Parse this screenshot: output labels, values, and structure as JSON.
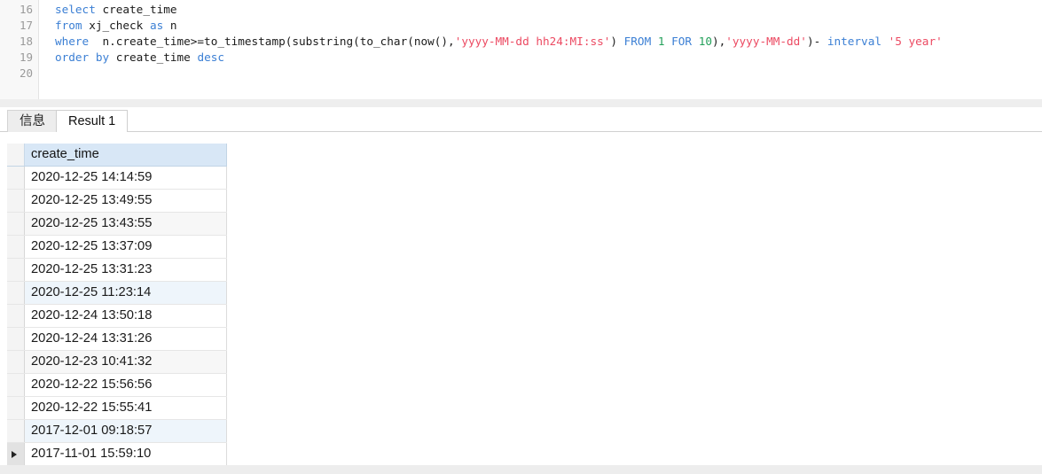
{
  "editor": {
    "line_numbers": [
      "16",
      "17",
      "18",
      "19",
      "20"
    ],
    "lines": [
      {
        "number": "16",
        "text": "select create_time",
        "tokens": [
          {
            "t": "select",
            "c": "kw"
          },
          {
            "t": " create_time",
            "c": "pln"
          }
        ]
      },
      {
        "number": "17",
        "text": "from xj_check as n",
        "tokens": [
          {
            "t": "from",
            "c": "kw"
          },
          {
            "t": " xj_check ",
            "c": "pln"
          },
          {
            "t": "as",
            "c": "kw"
          },
          {
            "t": " n",
            "c": "pln"
          }
        ]
      },
      {
        "number": "18",
        "text": "where  n.create_time>=to_timestamp(substring(to_char(now(),'yyyy-MM-dd hh24:MI:ss') FROM 1 FOR 10),'yyyy-MM-dd')- interval '5 year'",
        "tokens": [
          {
            "t": "where",
            "c": "kw"
          },
          {
            "t": "  n.create_time>=to_timestamp(substring(to_char(now(),",
            "c": "pln"
          },
          {
            "t": "'yyyy-MM-dd hh24:MI:ss'",
            "c": "str"
          },
          {
            "t": ") ",
            "c": "pln"
          },
          {
            "t": "FROM",
            "c": "kw"
          },
          {
            "t": " ",
            "c": "pln"
          },
          {
            "t": "1",
            "c": "num"
          },
          {
            "t": " ",
            "c": "pln"
          },
          {
            "t": "FOR",
            "c": "kw"
          },
          {
            "t": " ",
            "c": "pln"
          },
          {
            "t": "10",
            "c": "num"
          },
          {
            "t": "),",
            "c": "pln"
          },
          {
            "t": "'yyyy-MM-dd'",
            "c": "str"
          },
          {
            "t": ")- ",
            "c": "pln"
          },
          {
            "t": "interval",
            "c": "kw"
          },
          {
            "t": " ",
            "c": "pln"
          },
          {
            "t": "'5 year'",
            "c": "str"
          }
        ]
      },
      {
        "number": "19",
        "text": "order by create_time desc",
        "tokens": [
          {
            "t": "order",
            "c": "kw"
          },
          {
            "t": " ",
            "c": "pln"
          },
          {
            "t": "by",
            "c": "kw"
          },
          {
            "t": " create_time ",
            "c": "pln"
          },
          {
            "t": "desc",
            "c": "kw"
          }
        ]
      },
      {
        "number": "20",
        "text": "",
        "tokens": []
      }
    ]
  },
  "result_pane": {
    "tabs": [
      {
        "label": "信息",
        "active": false,
        "name": "tab-info"
      },
      {
        "label": "Result 1",
        "active": true,
        "name": "tab-result"
      }
    ],
    "grid": {
      "columns": [
        "create_time"
      ],
      "rows": [
        {
          "create_time": "2020-12-25 14:14:59",
          "bg": "bg-white",
          "selected": false
        },
        {
          "create_time": "2020-12-25 13:49:55",
          "bg": "bg-white",
          "selected": false
        },
        {
          "create_time": "2020-12-25 13:43:55",
          "bg": "bg-gray",
          "selected": false
        },
        {
          "create_time": "2020-12-25 13:37:09",
          "bg": "bg-white",
          "selected": false
        },
        {
          "create_time": "2020-12-25 13:31:23",
          "bg": "bg-white",
          "selected": false
        },
        {
          "create_time": "2020-12-25 11:23:14",
          "bg": "bg-blue",
          "selected": false
        },
        {
          "create_time": "2020-12-24 13:50:18",
          "bg": "bg-white",
          "selected": false
        },
        {
          "create_time": "2020-12-24 13:31:26",
          "bg": "bg-white",
          "selected": false
        },
        {
          "create_time": "2020-12-23 10:41:32",
          "bg": "bg-gray",
          "selected": false
        },
        {
          "create_time": "2020-12-22 15:56:56",
          "bg": "bg-white",
          "selected": false
        },
        {
          "create_time": "2020-12-22 15:55:41",
          "bg": "bg-white",
          "selected": false
        },
        {
          "create_time": "2017-12-01 09:18:57",
          "bg": "bg-blue",
          "selected": false
        },
        {
          "create_time": "2017-11-01 15:59:10",
          "bg": "bg-white",
          "selected": true
        }
      ],
      "row_count": 13,
      "selected_row_index": 12,
      "selection_indicator_icon": "triangle-right-icon"
    }
  },
  "colors": {
    "keyword": "#3b7fd4",
    "string": "#ec4a62",
    "number": "#23a05a",
    "plain": "#1b1b1b",
    "header_bg": "#d8e7f6",
    "row_alt_gray": "#f7f7f7",
    "row_alt_blue": "#eef5fb",
    "gutter_bg": "#f8f8f8"
  }
}
